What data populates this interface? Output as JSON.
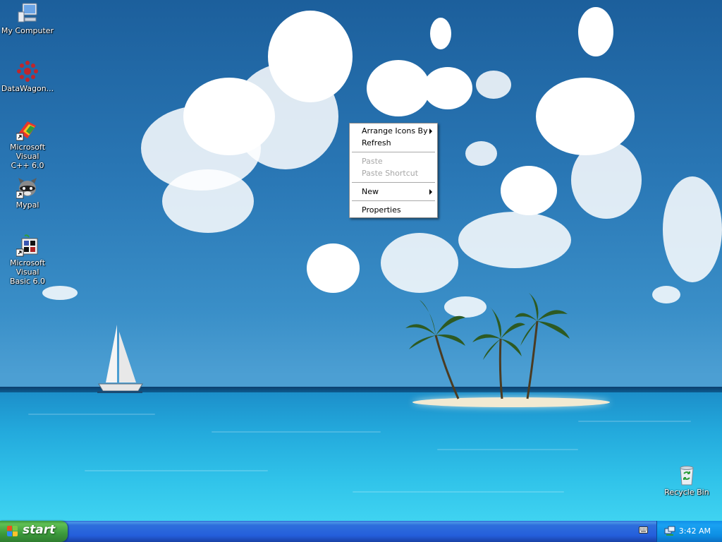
{
  "desktop_icons": [
    {
      "name": "My Computer",
      "label": "My Computer"
    },
    {
      "name": "DataWagon",
      "label": "DataWagon..."
    },
    {
      "name": "Microsoft Visual C++ 6.0",
      "label": "Microsoft Visual\nC++ 6.0"
    },
    {
      "name": "Mypal",
      "label": "Mypal"
    },
    {
      "name": "Microsoft Visual Basic 6.0",
      "label": "Microsoft Visual\nBasic 6.0"
    },
    {
      "name": "Recycle Bin",
      "label": "Recycle Bin"
    }
  ],
  "context_menu": {
    "items": [
      {
        "label": "Arrange Icons By",
        "submenu": true,
        "enabled": true
      },
      {
        "label": "Refresh",
        "submenu": false,
        "enabled": true
      },
      {
        "label": "Paste",
        "submenu": false,
        "enabled": false
      },
      {
        "label": "Paste Shortcut",
        "submenu": false,
        "enabled": false
      },
      {
        "label": "New",
        "submenu": true,
        "enabled": true
      },
      {
        "label": "Properties",
        "submenu": false,
        "enabled": true
      }
    ]
  },
  "taskbar": {
    "start_label": "start",
    "clock": "3:42 AM",
    "tray_icons": [
      "keyboard-icon",
      "network-icon"
    ]
  },
  "colors": {
    "taskbar_blue": "#245edb",
    "start_green": "#3c9a3c",
    "tray_blue": "#0d8ee3"
  }
}
